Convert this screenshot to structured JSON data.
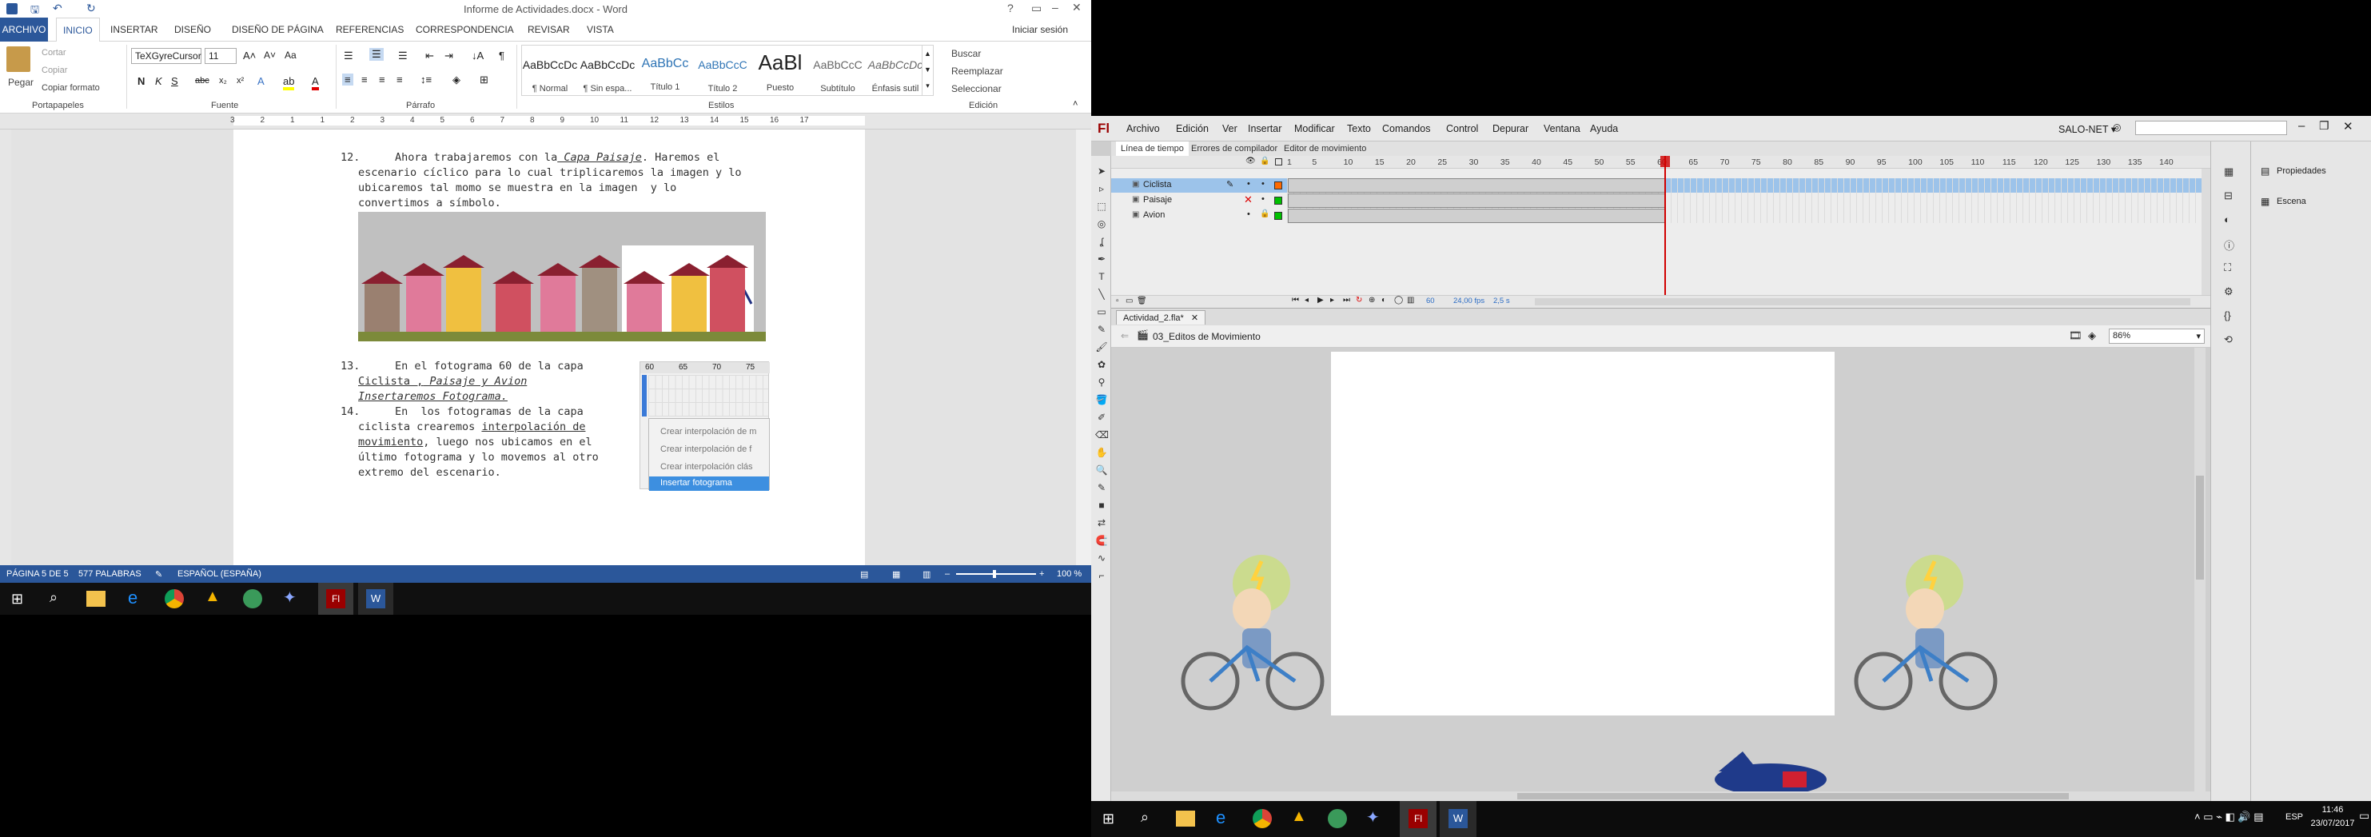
{
  "word": {
    "title": "Informe de Actividades.docx - Word",
    "signin": "Iniciar sesión",
    "tabs": [
      "ARCHIVO",
      "INICIO",
      "INSERTAR",
      "DISEÑO",
      "DISEÑO DE PÁGINA",
      "REFERENCIAS",
      "CORRESPONDENCIA",
      "REVISAR",
      "VISTA"
    ],
    "clipboard": {
      "paste": "Pegar",
      "cut": "Cortar",
      "copy": "Copiar",
      "format": "Copiar formato",
      "label": "Portapapeles"
    },
    "font": {
      "name": "TeXGyreCursor",
      "size": "11",
      "label": "Fuente"
    },
    "paragraph_label": "Párrafo",
    "styles_label": "Estilos",
    "styles": [
      {
        "preview": "AaBbCcDc",
        "name": "¶ Normal"
      },
      {
        "preview": "AaBbCcDc",
        "name": "¶ Sin espa..."
      },
      {
        "preview": "AaBbCc",
        "name": "Título 1"
      },
      {
        "preview": "AaBbCcC",
        "name": "Título 2"
      },
      {
        "preview": "AaBl",
        "name": "Puesto"
      },
      {
        "preview": "AaBbCcC",
        "name": "Subtítulo"
      },
      {
        "preview": "AaBbCcDc",
        "name": "Énfasis sutil"
      }
    ],
    "editing": {
      "find": "Buscar",
      "replace": "Reemplazar",
      "select": "Seleccionar",
      "label": "Edición"
    },
    "ruler_ticks": [
      "3",
      "2",
      "1",
      "1",
      "2",
      "3",
      "4",
      "5",
      "6",
      "7",
      "8",
      "9",
      "10",
      "11",
      "12",
      "13",
      "14",
      "15",
      "16",
      "17"
    ],
    "doc": {
      "p12_num": "12.",
      "p12_l1": "Ahora trabajaremos con la",
      "p12_l1b": " Capa Paisaje",
      "p12_l1c": ". Haremos el",
      "p12_l2": "escenario cíclico para lo cual triplicaremos la imagen y lo",
      "p12_l3": "ubicaremos tal momo se muestra en la imagen  y lo",
      "p12_l4": "convertimos a símbolo.",
      "p13_num": "13.",
      "p13_l1": "En el fotograma 60 de la capa",
      "p13_l2a": "Ciclista ,",
      "p13_l2b": " Paisaje y Avion",
      "p13_l3": "Insertaremos Fotograma.",
      "p14_num": "14.",
      "p14_l1": "En  los fotogramas de la capa",
      "p14_l2a": "ciclista crearemos ",
      "p14_l2b": "interpolación de",
      "p14_l3a": "movimiento",
      "p14_l3b": ", luego nos ubicamos en el",
      "p14_l4": "último fotograma y lo movemos al otro",
      "p14_l5": "extremo del escenario.",
      "mini_ticks": [
        "60",
        "65",
        "70",
        "75"
      ],
      "menu_items": [
        "Crear interpolación de m",
        "Crear interpolación de f",
        "Crear interpolación clás",
        "Insertar fotograma"
      ]
    },
    "status": {
      "page": "PÁGINA 5 DE 5",
      "words": "577 PALABRAS",
      "lang": "ESPAÑOL (ESPAÑA)",
      "zoom": "100 %"
    }
  },
  "flash": {
    "logo": "Fl",
    "menu": [
      "Archivo",
      "Edición",
      "Ver",
      "Insertar",
      "Modificar",
      "Texto",
      "Comandos",
      "Control",
      "Depurar",
      "Ventana",
      "Ayuda"
    ],
    "workspace": "SALO-NET",
    "panel_tabs": [
      "Línea de tiempo",
      "Errores de compilador",
      "Editor de movimiento"
    ],
    "layers": [
      {
        "name": "Ciclista",
        "selected": true,
        "color": "#ff6a00"
      },
      {
        "name": "Paisaje",
        "selected": false,
        "color": "#00c000"
      },
      {
        "name": "Avion",
        "selected": false,
        "color": "#00c000"
      }
    ],
    "frame_ticks": [
      "1",
      "5",
      "10",
      "15",
      "20",
      "25",
      "30",
      "35",
      "40",
      "45",
      "50",
      "55",
      "60",
      "65",
      "70",
      "75",
      "80",
      "85",
      "90",
      "95",
      "100",
      "105",
      "110",
      "115",
      "120",
      "125",
      "130",
      "135",
      "140"
    ],
    "playhead_frame": 60,
    "tl_status": {
      "frame": "60",
      "fps": "24,00 fps",
      "time": "2,5 s"
    },
    "doc_tab": "Actividad_2.fla*",
    "scene": "03_Editos de Movimiento",
    "zoom": "86%",
    "props": {
      "properties": "Propiedades",
      "scene": "Escena"
    }
  },
  "taskbar": {
    "time": "11:46",
    "date": "23/07/2017",
    "lang": "ESP"
  },
  "colors": {
    "word_blue": "#2b579a",
    "flash_red": "#9a0000",
    "timeline_select": "#9cc3ea"
  }
}
